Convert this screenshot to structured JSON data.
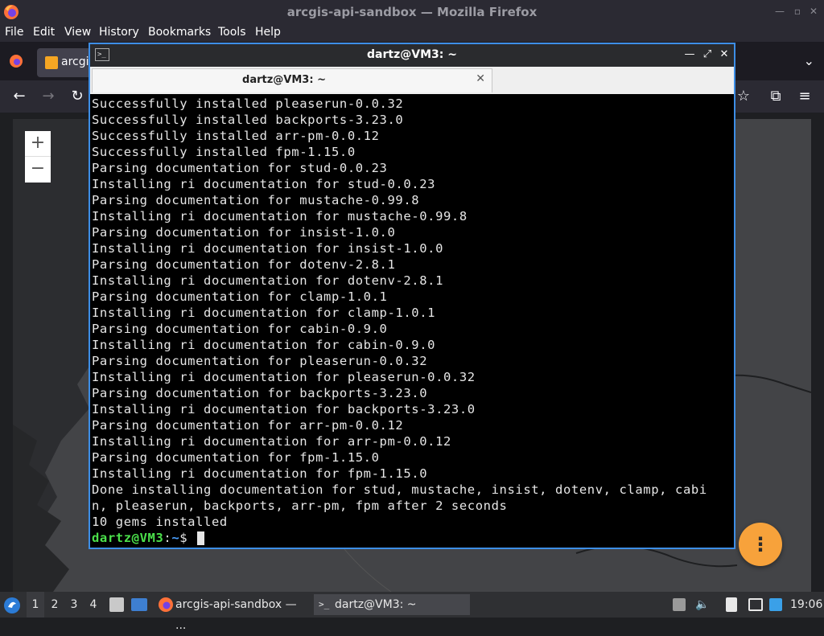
{
  "firefox": {
    "window_title": "arcgis-api-sandbox — Mozilla Firefox",
    "menu": [
      "File",
      "Edit",
      "View",
      "History",
      "Bookmarks",
      "Tools",
      "Help"
    ],
    "tab_label": "arcgi",
    "zoom_in": "+",
    "zoom_out": "−",
    "fab_icon": "⋮"
  },
  "terminal": {
    "window_title": "dartz@VM3: ~",
    "tab_label": "dartz@VM3: ~",
    "lines": [
      "Successfully installed pleaserun-0.0.32",
      "Successfully installed backports-3.23.0",
      "Successfully installed arr-pm-0.0.12",
      "Successfully installed fpm-1.15.0",
      "Parsing documentation for stud-0.0.23",
      "Installing ri documentation for stud-0.0.23",
      "Parsing documentation for mustache-0.99.8",
      "Installing ri documentation for mustache-0.99.8",
      "Parsing documentation for insist-1.0.0",
      "Installing ri documentation for insist-1.0.0",
      "Parsing documentation for dotenv-2.8.1",
      "Installing ri documentation for dotenv-2.8.1",
      "Parsing documentation for clamp-1.0.1",
      "Installing ri documentation for clamp-1.0.1",
      "Parsing documentation for cabin-0.9.0",
      "Installing ri documentation for cabin-0.9.0",
      "Parsing documentation for pleaserun-0.0.32",
      "Installing ri documentation for pleaserun-0.0.32",
      "Parsing documentation for backports-3.23.0",
      "Installing ri documentation for backports-3.23.0",
      "Parsing documentation for arr-pm-0.0.12",
      "Installing ri documentation for arr-pm-0.0.12",
      "Parsing documentation for fpm-1.15.0",
      "Installing ri documentation for fpm-1.15.0",
      "Done installing documentation for stud, mustache, insist, dotenv, clamp, cabi",
      "n, pleaserun, backports, arr-pm, fpm after 2 seconds",
      "10 gems installed"
    ],
    "prompt_user": "dartz@VM3",
    "prompt_sep": ":",
    "prompt_path": "~",
    "prompt_symbol": "$ "
  },
  "taskbar": {
    "workspaces": [
      "1",
      "2",
      "3",
      "4"
    ],
    "tasks": [
      {
        "label": "arcgis-api-sandbox — ..."
      },
      {
        "label": "dartz@VM3: ~"
      }
    ],
    "clock": "19:06"
  },
  "colors": {
    "terminal_accent": "#3d8ee6",
    "prompt_user": "#4be04b",
    "prompt_path": "#4aa0ff",
    "fab": "#f7a23b"
  }
}
